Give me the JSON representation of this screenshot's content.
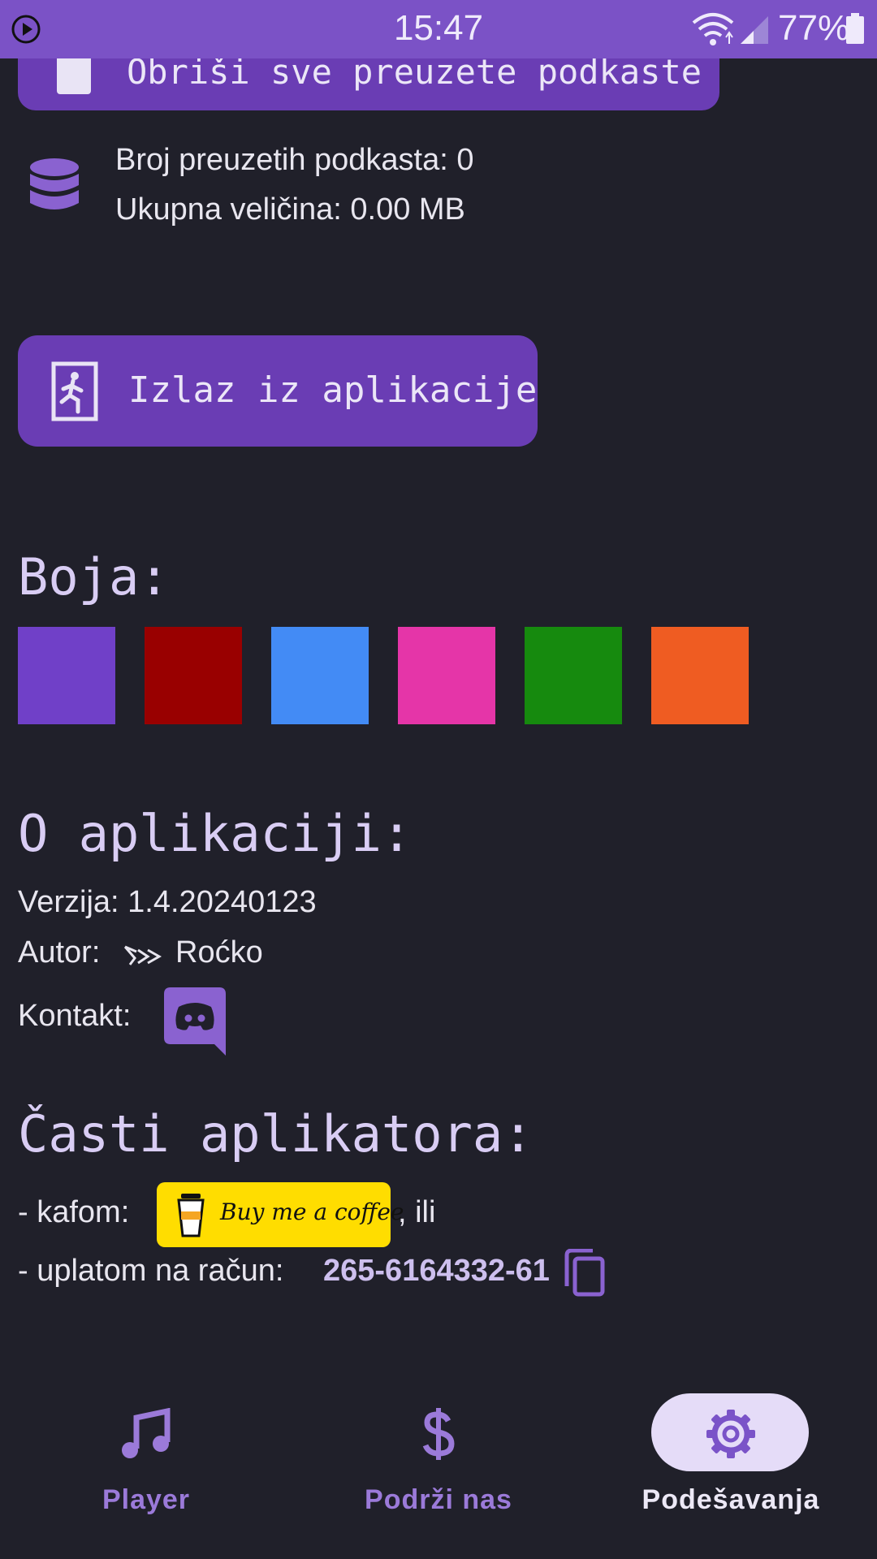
{
  "status_bar": {
    "time": "15:47",
    "battery": "77%"
  },
  "storage": {
    "delete_button_label": "Obriši sve preuzete podkaste",
    "downloaded_count": "Broj preuzetih podkasta: 0",
    "total_size": "Ukupna veličina: 0.00 MB"
  },
  "exit_button_label": "Izlaz iz aplikacije",
  "color": {
    "heading": "Boja:",
    "swatches": [
      "#7040c8",
      "#990000",
      "#438bf5",
      "#e535a8",
      "#168a0e",
      "#ef5c22"
    ]
  },
  "about": {
    "heading": "O aplikaciji:",
    "version": "Verzija: 1.4.20240123",
    "author_label": "Autor:",
    "author_name": "Roćko",
    "contact_label": "Kontakt:"
  },
  "support": {
    "heading": "Časti aplikatora:",
    "coffee_prefix": "- kafom:",
    "coffee_button": "Buy me a coffee",
    "coffee_suffix": ", ili",
    "account_prefix": "- uplatom na račun:",
    "account_number": "265-6164332-61"
  },
  "nav": {
    "items": [
      {
        "label": "Player",
        "icon": "music-note-icon"
      },
      {
        "label": "Podrži nas",
        "icon": "dollar-icon"
      },
      {
        "label": "Podešavanja",
        "icon": "gear-icon"
      }
    ],
    "active": "Podešavanja"
  },
  "colors": {
    "accent": "#6a3db4",
    "background": "#20202a",
    "status_bar": "#7b52c6"
  }
}
